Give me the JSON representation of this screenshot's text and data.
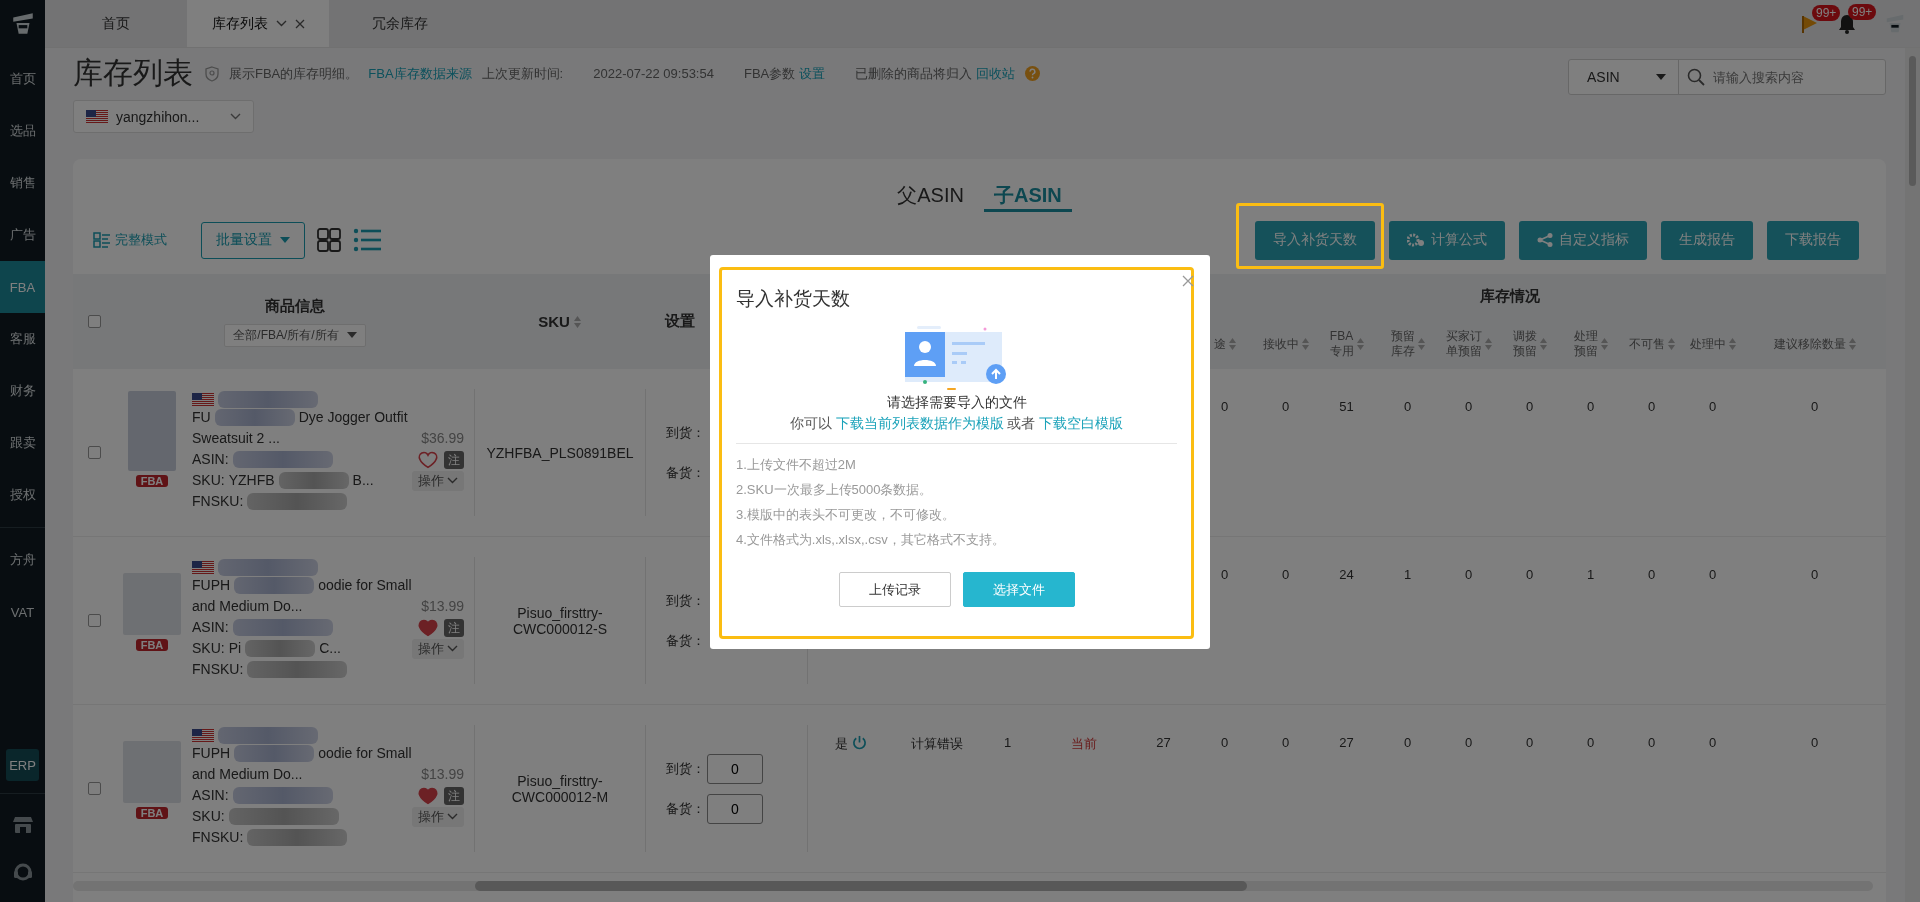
{
  "sidebar": {
    "groups": [
      [
        {
          "label": "首页",
          "selected": false
        },
        {
          "label": "选品",
          "selected": false
        },
        {
          "label": "销售",
          "selected": false
        },
        {
          "label": "广告",
          "selected": false
        },
        {
          "label": "FBA",
          "selected": true
        },
        {
          "label": "客服",
          "selected": false
        },
        {
          "label": "财务",
          "selected": false
        },
        {
          "label": "跟卖",
          "selected": false
        },
        {
          "label": "授权",
          "selected": false
        }
      ],
      [
        {
          "label": "方舟",
          "selected": false
        },
        {
          "label": "VAT",
          "selected": false
        }
      ]
    ],
    "erp": "ERP"
  },
  "tabs": [
    {
      "label": "首页",
      "selected": false,
      "closable": false
    },
    {
      "label": "库存列表",
      "selected": true,
      "closable": true
    },
    {
      "label": "冗余库存",
      "selected": false,
      "closable": false
    }
  ],
  "notifications": [
    {
      "kind": "flag",
      "badge": "99+"
    },
    {
      "kind": "bell",
      "badge": "99+"
    }
  ],
  "header": {
    "title": "库存列表",
    "description": "展示FBA的库存明细。",
    "source_link": "FBA库存数据来源",
    "updated_label": "上次更新时间:",
    "updated_time": "2022-07-22 09:53:54",
    "params_label": "FBA参数",
    "params_link": "设置",
    "recycle_text": "已删除的商品将归入",
    "recycle_link": "回收站"
  },
  "account": {
    "name": "yangzhihon..."
  },
  "search": {
    "field": "ASIN",
    "placeholder": "请输入搜索内容"
  },
  "asin_tabs": [
    {
      "label": "父ASIN",
      "selected": false
    },
    {
      "label": "子ASIN",
      "selected": true
    }
  ],
  "toolbar": {
    "mode_label": "完整模式",
    "batch_label": "批量设置",
    "views": [
      {
        "kind": "grid",
        "selected": false
      },
      {
        "kind": "list",
        "selected": true
      }
    ],
    "buttons": [
      {
        "label": "导入补货天数",
        "kind": "plain",
        "highlighted": true
      },
      {
        "label": "计算公式",
        "kind": "gear",
        "highlighted": false
      },
      {
        "label": "自定义指标",
        "kind": "share",
        "highlighted": false
      },
      {
        "label": "生成报告",
        "kind": "plain",
        "highlighted": false
      },
      {
        "label": "下载报告",
        "kind": "plain",
        "highlighted": false
      }
    ]
  },
  "table": {
    "select_all_checked": false,
    "product_column": "商品信息",
    "product_filter": "全部/FBA/所有/所有",
    "sku_column": "SKU",
    "settings_column": "设置",
    "stock_group": "库存情况",
    "stock_columns": [
      {
        "lines": [
          "途"
        ]
      },
      {
        "lines": [
          "接收中"
        ]
      },
      {
        "lines": [
          "FBA",
          "专用"
        ]
      },
      {
        "lines": [
          "预留",
          "库存"
        ]
      },
      {
        "lines": [
          "买家订",
          "单预留"
        ]
      },
      {
        "lines": [
          "调拨",
          "预留"
        ]
      },
      {
        "lines": [
          "处理",
          "预留"
        ]
      },
      {
        "lines": [
          "不可售"
        ]
      },
      {
        "lines": [
          "处理中"
        ]
      },
      {
        "lines": [
          "建议移除数量"
        ]
      }
    ],
    "rows": [
      {
        "checked": false,
        "product": {
          "title_head": "FU",
          "title_tail": "Dye Jogger Outfit",
          "title_line2": "Sweatsuit 2 ...",
          "price": "$36.99",
          "asin_label": "ASIN:",
          "sku_label": "SKU:",
          "sku_head": "YZHFB",
          "sku_tail": "B...",
          "fnsku_label": "FNSKU:",
          "favorited": false,
          "note": "注",
          "action": "操作",
          "badge": "FBA"
        },
        "sku": "YZHFBA_PLS0891BEL",
        "arrival_label": "到货：",
        "stock_label": "备货：",
        "stock": [
          "0",
          "0",
          "51",
          "0",
          "0",
          "0",
          "0",
          "0",
          "0",
          "0"
        ]
      },
      {
        "checked": false,
        "product": {
          "title_head": "FUPH",
          "title_tail": "oodie for Small",
          "title_line2": "and Medium Do...",
          "price": "$13.99",
          "asin_label": "ASIN:",
          "sku_label": "SKU:",
          "sku_head": "Pi",
          "sku_tail": "C...",
          "fnsku_label": "FNSKU:",
          "favorited": true,
          "note": "注",
          "action": "操作",
          "badge": "FBA"
        },
        "sku": "Pisuo_firsttry-CWC000012-S",
        "arrival_label": "到货：",
        "stock_label": "备货：",
        "stock": [
          "0",
          "0",
          "24",
          "1",
          "0",
          "0",
          "1",
          "0",
          "0",
          "0"
        ]
      },
      {
        "checked": false,
        "product": {
          "title_head": "FUPH",
          "title_tail": "oodie for Small",
          "title_line2": "and Medium Do...",
          "price": "$13.99",
          "asin_label": "ASIN:",
          "sku_label": "SKU:",
          "fnsku_label": "FNSKU:",
          "favorited": true,
          "note": "注",
          "action": "操作",
          "badge": "FBA"
        },
        "sku": "Pisuo_firsttry-CWC000012-M",
        "arrival_label": "到货：",
        "arrival_value": "0",
        "stock_label": "备货：",
        "stock_value": "0",
        "column_4": "是",
        "column_5": "计算错误",
        "column_6": "1",
        "column_7": "当前",
        "stock": [
          "27",
          "0",
          "0",
          "27",
          "0",
          "0",
          "0",
          "0",
          "0",
          "0",
          "0"
        ]
      }
    ]
  },
  "modal": {
    "title": "导入补货天数",
    "highlighted": true,
    "prompt": "请选择需要导入的文件",
    "hint_prefix": "你可以",
    "link_current": "下载当前列表数据作为模版",
    "hint_or": "或者",
    "link_blank": "下载空白模版",
    "rules": [
      "1.上传文件不超过2M",
      "2.SKU一次最多上传5000条数据。",
      "3.模版中的表头不可更改，不可修改。",
      "4.文件格式为.xls,.xlsx,.csv，其它格式不支持。"
    ],
    "buttons": [
      {
        "label": "上传记录",
        "kind": "default"
      },
      {
        "label": "选择文件",
        "kind": "primary"
      }
    ]
  }
}
